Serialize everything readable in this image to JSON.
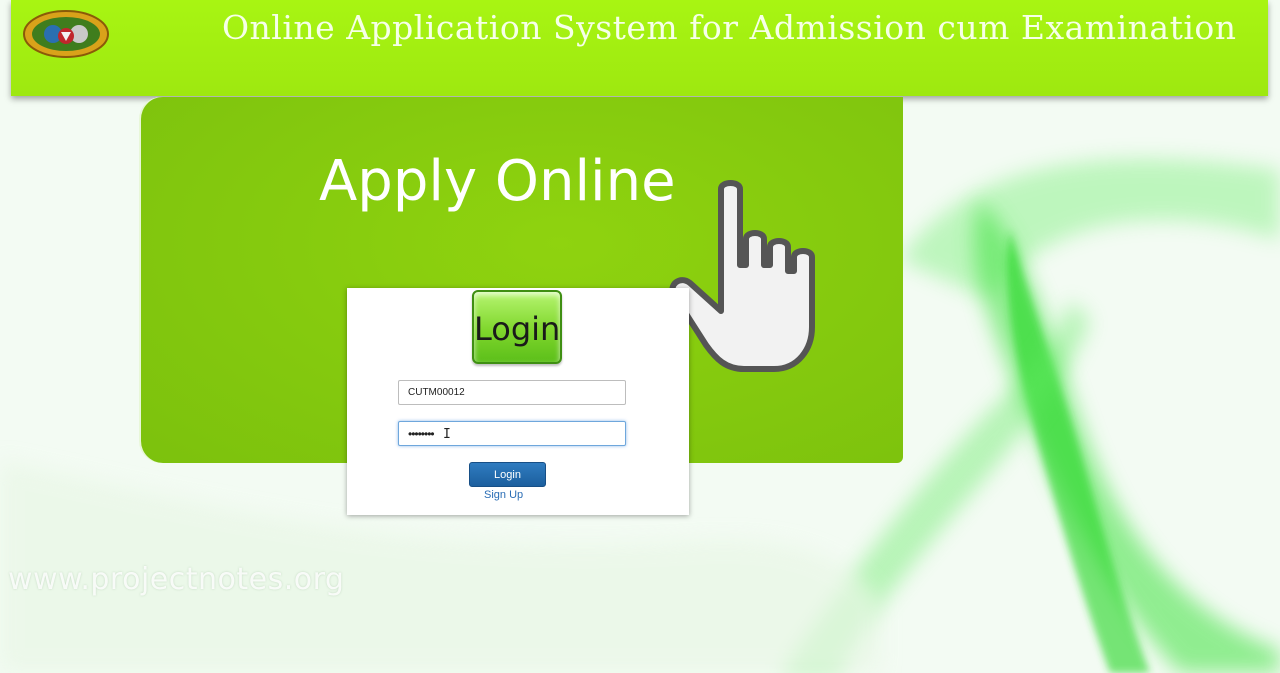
{
  "header": {
    "title": "Online Application System for Admission cum Examination",
    "logo_icon": "university-emblem-icon"
  },
  "banner": {
    "heading": "Apply Online",
    "pointer_icon": "pointing-hand-icon"
  },
  "login": {
    "badge_label": "Login",
    "username_value": "CUTM00012",
    "password_value": "••••••••",
    "submit_label": "Login",
    "signup_label": "Sign Up"
  },
  "watermark": "www.projectnotes.org",
  "colors": {
    "header_green": "#a8f512",
    "banner_green": "#86cb0e",
    "button_blue": "#1c5f9e",
    "link_blue": "#2a6db5"
  }
}
